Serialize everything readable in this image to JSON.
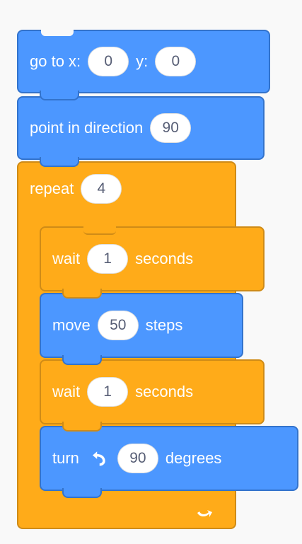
{
  "script": {
    "go_to": {
      "label": "go to x:",
      "x_value": "0",
      "y_label": "y:",
      "y_value": "0"
    },
    "point": {
      "label": "point in direction",
      "value": "90"
    },
    "repeat": {
      "label": "repeat",
      "value": "4"
    },
    "wait1": {
      "label": "wait",
      "value": "1",
      "suffix": "seconds"
    },
    "move": {
      "label": "move",
      "value": "50",
      "suffix": "steps"
    },
    "wait2": {
      "label": "wait",
      "value": "1",
      "suffix": "seconds"
    },
    "turn": {
      "label": "turn",
      "icon": "turn-left-icon",
      "value": "90",
      "suffix": "degrees"
    }
  },
  "colors": {
    "motion": "#4c97ff",
    "motion_border": "#3373cc",
    "control": "#ffab19",
    "control_border": "#cf8b17",
    "workspace": "#f9f9f9"
  }
}
